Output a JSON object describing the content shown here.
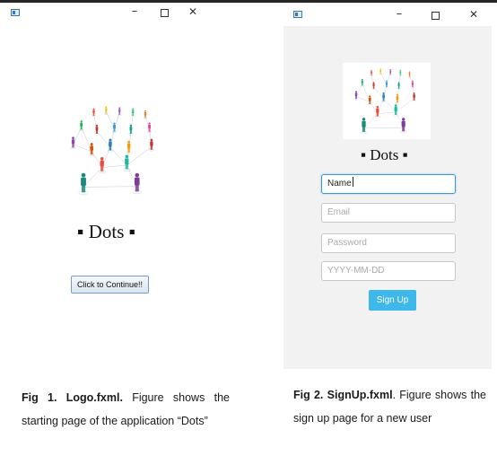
{
  "window1": {
    "controls": {
      "minimize": "–",
      "close": "✕"
    },
    "title": "▪ Dots ▪",
    "continue_button": "Click to Continue!!"
  },
  "window2": {
    "controls": {
      "minimize": "–",
      "close": "✕"
    },
    "title": "▪ Dots ▪",
    "fields": {
      "name_value": "Name",
      "email_placeholder": "Email",
      "password_placeholder": "Password",
      "dob_placeholder": "YYYY-MM-DD"
    },
    "signup_button": "Sign Up"
  },
  "captions": {
    "fig1_label": "Fig 1. Logo.fxml.",
    "fig1_text": " Figure shows the starting page of the application “Dots”",
    "fig2_label": "Fig 2. SignUp.fxml",
    "fig2_text": ". Figure shows the sign up page for a new user"
  },
  "icons": [
    "app-icon",
    "minimize-icon",
    "maximize-icon",
    "close-icon",
    "people-network-logo"
  ]
}
